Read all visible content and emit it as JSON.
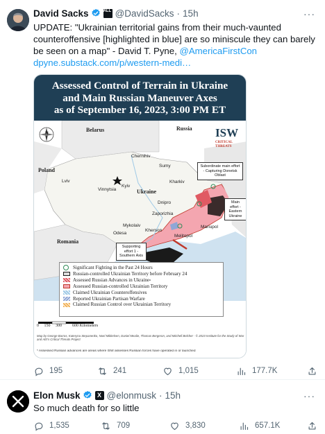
{
  "tweets": [
    {
      "author_name": "David Sacks",
      "handle": "@DavidSacks",
      "separator": "·",
      "time": "15h",
      "affiliation_badge": "ALL IN",
      "text_plain": "UPDATE: \"Ukrainian territorial gains from their much-vaunted counteroffensive [highlighted in blue] are so miniscule they can barely be seen on a map\" - David T. Pyne, ",
      "mention": "@AmericaFirstCon",
      "url": "dpyne.substack.com/p/western-medi…",
      "replies": "195",
      "retweets": "241",
      "likes": "1,015",
      "views": "177.7K"
    },
    {
      "author_name": "Elon Musk",
      "handle": "@elonmusk",
      "separator": "·",
      "time": "15h",
      "affiliation_badge": "X",
      "text_plain": "So much death for so little",
      "replies": "1,535",
      "retweets": "709",
      "likes": "3,830",
      "views": "657.1K"
    }
  ],
  "map_card": {
    "title_lines": [
      "Assessed Control of Terrain in Ukraine",
      "and Main Russian Maneuver Axes",
      "as of September 16, 2023, 3:00 PM ET"
    ],
    "countries": {
      "belarus": "Belarus",
      "russia": "Russia",
      "poland": "Poland",
      "ukraine": "Ukraine",
      "romania": "Romania"
    },
    "cities": {
      "chernihiv": "Chernihiv",
      "sumy": "Sumy",
      "kyiv": "Kyiv",
      "kharkiv": "Kharkiv",
      "lviv": "Lviv",
      "vinnytsia": "Vinnytsia",
      "dnipro": "Dnipro",
      "zaporizhia": "Zaporizhia",
      "mykolaiv": "Mykolaiv",
      "odesa": "Odesa",
      "kherson": "Kherson",
      "mariupol": "Mariupol",
      "melitopol": "Melitopol"
    },
    "compass": "N",
    "isw_logo": "ISW",
    "ct_logo_line1": "CRITICAL",
    "ct_logo_line2": "THREATS",
    "callouts": {
      "subordinate": "Subordinate main effort - Capturing Donetsk Oblast",
      "main_effort": "Main effort - Eastern Ukraine",
      "supporting": "Supporting effort 1 - Southern Axis"
    },
    "legend": [
      {
        "label": "Significant Fighting in the Past 24 Hours",
        "color": "#2e8b57"
      },
      {
        "label": "Russian-controlled Ukrainian Territory before February 24",
        "color": "#1a1a1a"
      },
      {
        "label": "Assessed Russian Advances in Ukraine",
        "color": "#e05a63"
      },
      {
        "label": "Assessed Russian-controlled Ukrainian Territory",
        "color": "#f4a6b0"
      },
      {
        "label": "Claimed Ukrainian Counteroffensives",
        "color": "#9ec9e6"
      },
      {
        "label": "Reported Ukrainian Partisan Warfare",
        "color": "#8fa6d6"
      },
      {
        "label": "Claimed Russian Control over Ukrainian Territory",
        "color": "#f2b35a"
      }
    ],
    "legend_superscript": "a",
    "scale_text": "0     150     300          600 Kilometers",
    "credit": "Map by George Barros, Kateryna Stepanenko, Noel Mikkelsen, Daniel Mealie, Thomas Bergeron, and Mitchell Belcher · © 2023 Institute for the Study of War and AEI's Critical Threats Project",
    "footnote": "* Assessed Russian advances are areas where ISW assesses Russian forces have operated in or launched"
  },
  "colors": {
    "brand_blue": "#1d9bf0",
    "text_primary": "#0f1419",
    "text_secondary": "#536471",
    "map_title_bg": "#1f3f55"
  }
}
